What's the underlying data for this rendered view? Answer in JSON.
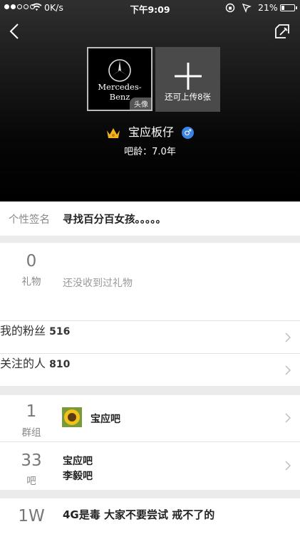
{
  "status_bar": {
    "speed": "0K/s",
    "time": "下午9:09",
    "battery": "21%"
  },
  "profile": {
    "avatar_brand": "Mercedes-Benz",
    "avatar_tag": "头像",
    "upload_label": "还可上传8张",
    "username": "宝应板仔",
    "gender_symbol": "♂",
    "account_age": "吧龄：7.0年"
  },
  "signature": {
    "label": "个性签名",
    "text": "寻找百分百女孩。。。。。"
  },
  "gifts": {
    "count": "0",
    "label": "礼物",
    "empty_text": "还没收到过礼物"
  },
  "fans": {
    "label": "我的粉丝",
    "value": "516"
  },
  "following": {
    "label": "关注的人",
    "value": "810"
  },
  "groups": {
    "count": "1",
    "label": "群组",
    "name": "宝应吧"
  },
  "forums": {
    "count": "33",
    "label": "吧",
    "items": [
      "宝应吧",
      "李毅吧"
    ]
  },
  "posts": {
    "count": "1W",
    "title": "4G是毒 大家不要尝试 戒不了的"
  },
  "colors": {
    "accent_blue": "#3b83e4",
    "header_bg": "#000000",
    "page_bg": "#ebebeb"
  }
}
